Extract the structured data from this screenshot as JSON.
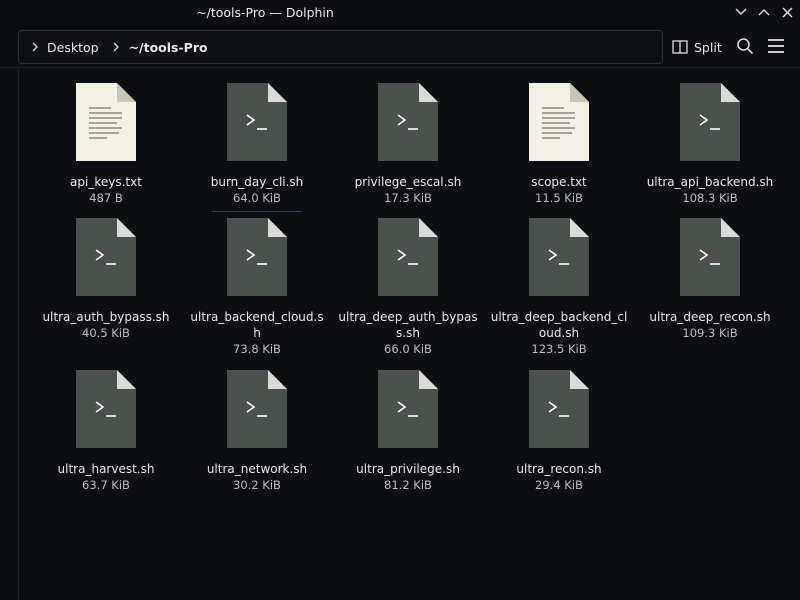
{
  "window": {
    "title": "~/tools-Pro — Dolphin"
  },
  "breadcrumb": {
    "items": [
      "Desktop",
      "~/tools-Pro"
    ]
  },
  "toolbar": {
    "split_label": "Split"
  },
  "files": [
    {
      "name": "api_keys.txt",
      "size": "487 B",
      "type": "text"
    },
    {
      "name": "burn_day_cli.sh",
      "size": "64.0 KiB",
      "type": "script"
    },
    {
      "name": "privilege_escal.sh",
      "size": "17.3 KiB",
      "type": "script"
    },
    {
      "name": "scope.txt",
      "size": "11.5 KiB",
      "type": "text"
    },
    {
      "name": "ultra_api_backend.sh",
      "size": "108.3 KiB",
      "type": "script"
    },
    {
      "name": "ultra_auth_bypass.sh",
      "size": "40.5 KiB",
      "type": "script"
    },
    {
      "name": "ultra_backend_cloud.sh",
      "size": "73.8 KiB",
      "type": "script"
    },
    {
      "name": "ultra_deep_auth_bypass.sh",
      "size": "66.0 KiB",
      "type": "script"
    },
    {
      "name": "ultra_deep_backend_cloud.sh",
      "size": "123.5 KiB",
      "type": "script"
    },
    {
      "name": "ultra_deep_recon.sh",
      "size": "109.3 KiB",
      "type": "script"
    },
    {
      "name": "ultra_harvest.sh",
      "size": "63.7 KiB",
      "type": "script"
    },
    {
      "name": "ultra_network.sh",
      "size": "30.2 KiB",
      "type": "script"
    },
    {
      "name": "ultra_privilege.sh",
      "size": "81.2 KiB",
      "type": "script"
    },
    {
      "name": "ultra_recon.sh",
      "size": "29.4 KiB",
      "type": "script"
    }
  ]
}
